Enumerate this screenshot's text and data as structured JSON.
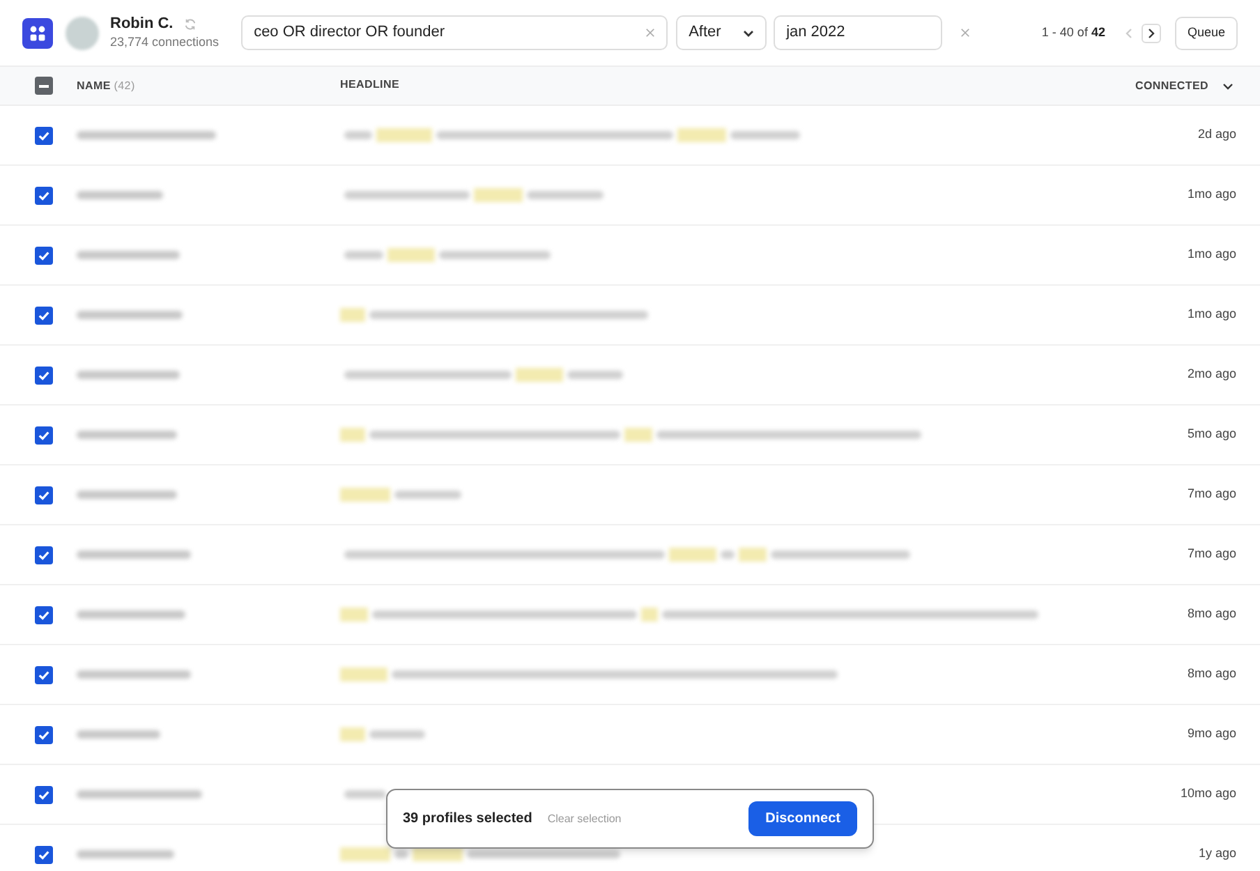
{
  "account": {
    "name": "Robin C.",
    "connections": "23,774 connections"
  },
  "search": {
    "value": "ceo OR director OR founder"
  },
  "date_filter": {
    "mode": "After",
    "value": "jan 2022"
  },
  "pagination": {
    "range": "1 - 40 of ",
    "total": "42",
    "prev_disabled": true,
    "next_disabled": false
  },
  "queue_button": "Queue",
  "table": {
    "select_all": {
      "indeterminate": true
    },
    "columns": [
      {
        "label": "NAME",
        "count": "(42)"
      },
      {
        "label": "HEADLINE"
      },
      {
        "label": "CONNECTED"
      }
    ],
    "rows": [
      {
        "checked": true,
        "connected": "2d ago"
      },
      {
        "checked": true,
        "connected": "1mo ago"
      },
      {
        "checked": true,
        "connected": "1mo ago"
      },
      {
        "checked": true,
        "connected": "1mo ago"
      },
      {
        "checked": true,
        "connected": "2mo ago"
      },
      {
        "checked": true,
        "connected": "5mo ago"
      },
      {
        "checked": true,
        "connected": "7mo ago"
      },
      {
        "checked": true,
        "connected": "7mo ago"
      },
      {
        "checked": true,
        "connected": "8mo ago"
      },
      {
        "checked": true,
        "connected": "8mo ago"
      },
      {
        "checked": true,
        "connected": "9mo ago"
      },
      {
        "checked": true,
        "connected": "10mo ago"
      },
      {
        "checked": true,
        "connected": "1y ago"
      }
    ]
  },
  "selection_bar": {
    "count": "39 profiles selected",
    "clear": "Clear selection",
    "action": "Disconnect"
  }
}
